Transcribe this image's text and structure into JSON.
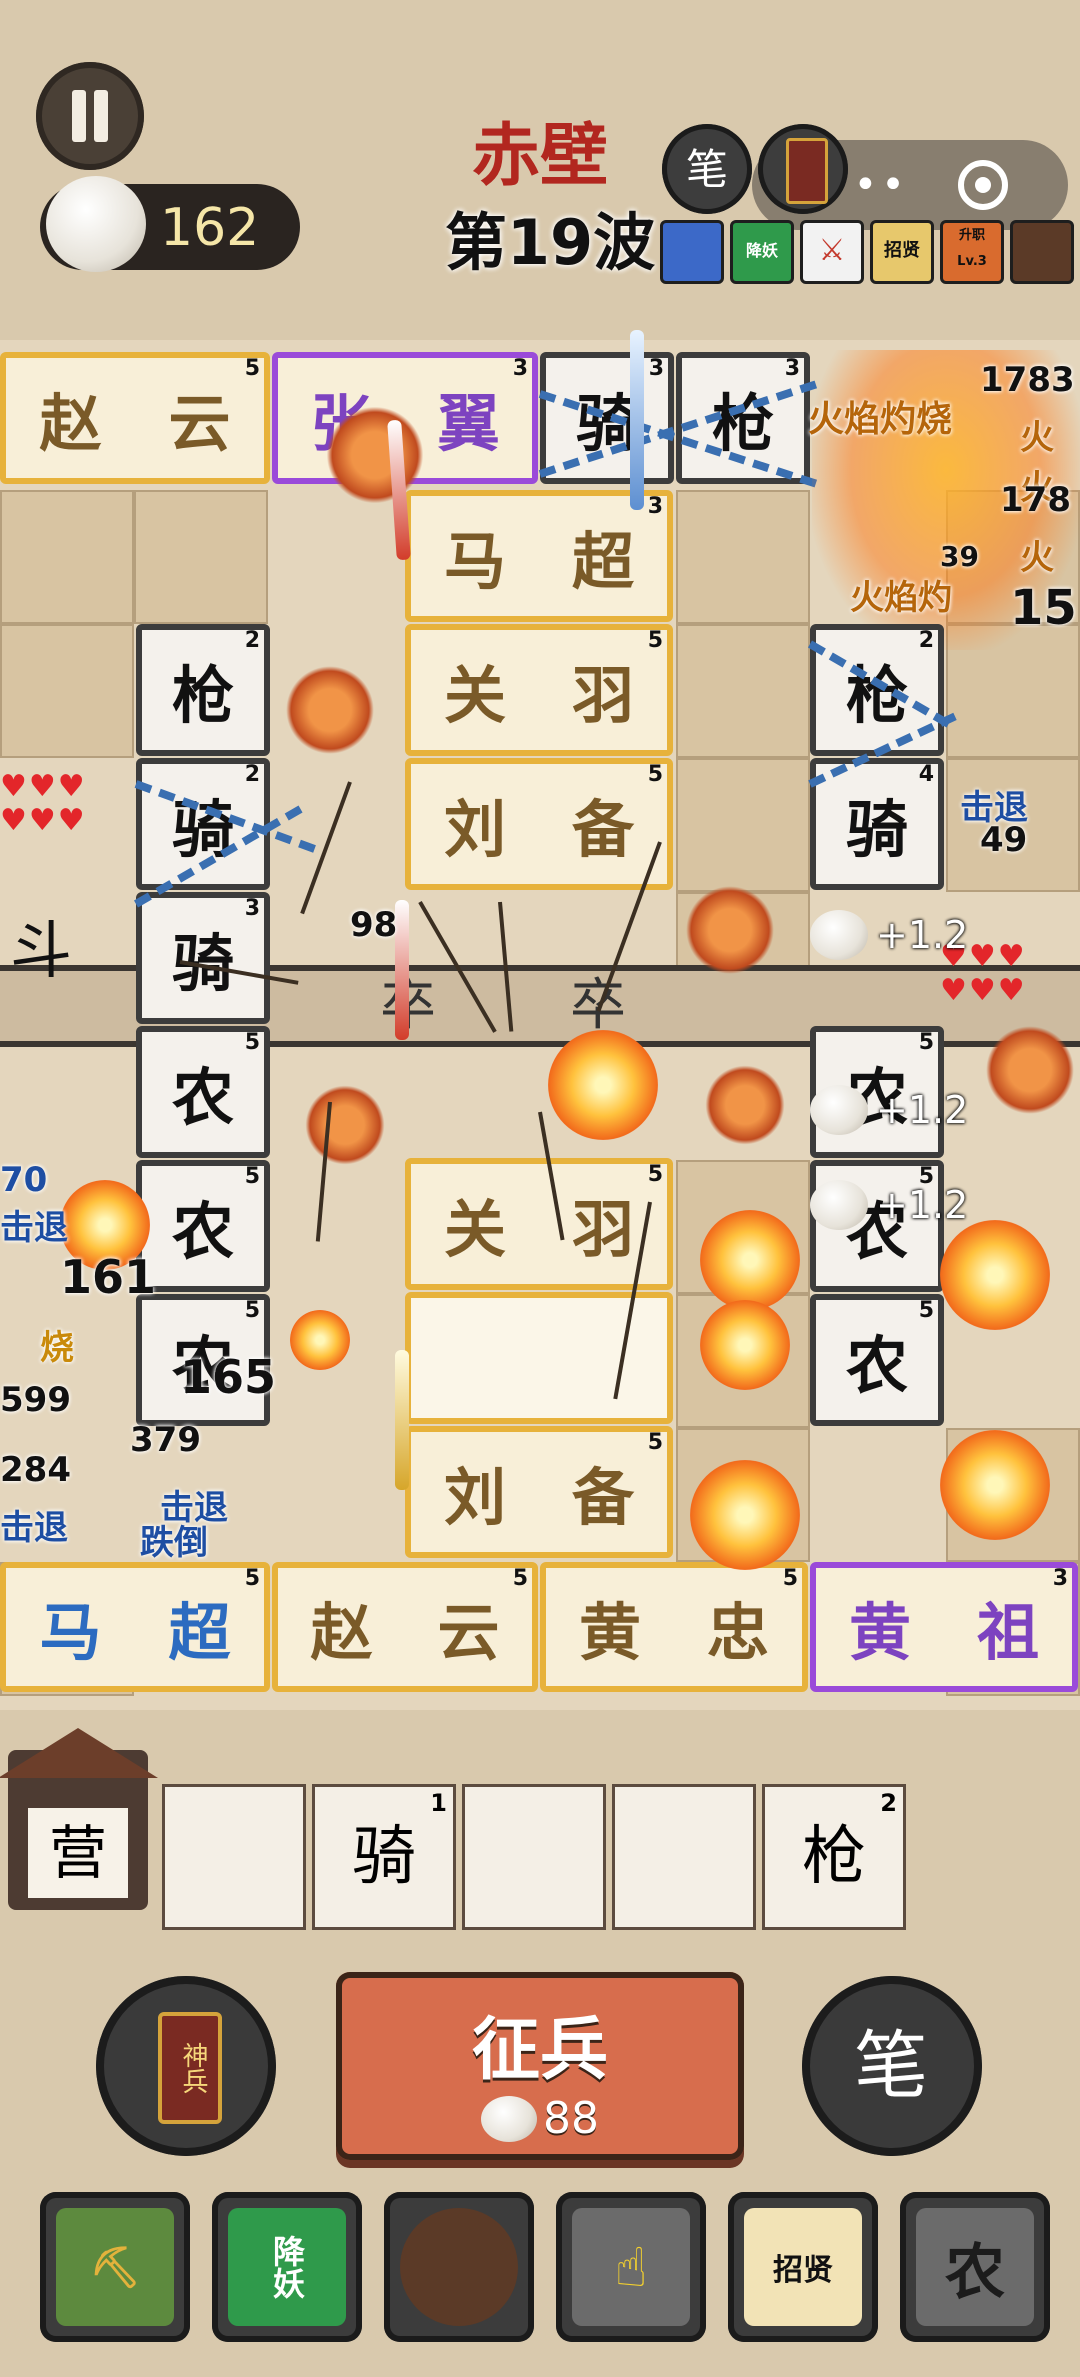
{
  "hud": {
    "coins": "162",
    "stage_title": "赤壁",
    "wave_label": "第19波",
    "pen_label": "笔",
    "divine_card_label": "神兵"
  },
  "buffs": [
    {
      "label": "",
      "color": "#3c69c8"
    },
    {
      "label": "降妖",
      "color": "#2f9a4b"
    },
    {
      "label": "",
      "color": "#c43a2d"
    },
    {
      "label": "招贤",
      "color": "#e7c86c"
    },
    {
      "label": "升职 Lv.3",
      "color": "#d96b2e"
    },
    {
      "label": "",
      "color": "#5b3a27"
    }
  ],
  "board": {
    "top_row": [
      {
        "name": "赵云",
        "chars": [
          "赵",
          "云"
        ],
        "level": "5",
        "style": "gold"
      },
      {
        "name": "张翼",
        "chars": [
          "张",
          "翼"
        ],
        "level": "3",
        "style": "purple"
      },
      {
        "name": "骑",
        "chars": [
          "骑"
        ],
        "level": "3",
        "style": "white"
      },
      {
        "name": "枪",
        "chars": [
          "枪"
        ],
        "level": "3",
        "style": "white"
      },
      {
        "name": "火焰",
        "chars": [],
        "level": "",
        "style": "fire"
      }
    ],
    "center_column": [
      {
        "chars": [
          "马",
          "超"
        ],
        "level": "3"
      },
      {
        "chars": [
          "关",
          "羽"
        ],
        "level": "5"
      },
      {
        "chars": [
          "刘",
          "备"
        ],
        "level": "5"
      },
      {
        "chars": [
          "卒"
        ],
        "level": ""
      },
      {
        "chars": [
          "关",
          "羽"
        ],
        "level": "5"
      },
      {
        "chars": [
          "刘",
          "备"
        ],
        "level": "5"
      }
    ],
    "bottom_row": [
      {
        "chars": [
          "马",
          "超"
        ],
        "level": "5",
        "style": "gold"
      },
      {
        "chars": [
          "赵",
          "云"
        ],
        "level": "5",
        "style": "gold"
      },
      {
        "chars": [
          "黄",
          "忠"
        ],
        "level": "5",
        "style": "gold"
      },
      {
        "chars": [
          "黄",
          "祖"
        ],
        "level": "3",
        "style": "purple"
      }
    ],
    "left_column": [
      {
        "char": "枪",
        "level": "2"
      },
      {
        "char": "骑",
        "level": "2"
      },
      {
        "char": "斗",
        "level": ""
      },
      {
        "char": "骑",
        "level": "3"
      },
      {
        "char": "农",
        "level": "5"
      },
      {
        "char": "农",
        "level": "5"
      },
      {
        "char": "农",
        "level": "5"
      }
    ],
    "right_column": [
      {
        "char": "枪",
        "level": "2"
      },
      {
        "char": "骑",
        "level": "4"
      },
      {
        "char": "农",
        "level": "5"
      },
      {
        "char": "农",
        "level": "5"
      },
      {
        "char": "农",
        "level": "5"
      }
    ],
    "soldier_label": "卒",
    "damage_texts": {
      "fire_burn_1": "火焰灼烧",
      "fire_burn_2": "火焰灼",
      "fire_right_1": "火",
      "fire_right_2": "火",
      "fire_right_3": "火",
      "num_a": "1783",
      "num_b": "178",
      "num_c": "39",
      "num_d": "15",
      "knockback_right": "击退",
      "num_49": "49",
      "num_98": "98",
      "num_70": "70",
      "knockback_left_1": "击退",
      "num_161": "161",
      "burn_left": "烧",
      "num_165": "165",
      "num_left_a": "599",
      "num_left_b": "379",
      "num_left_c": "284",
      "knockback_left_2": "击退",
      "knockback_left_3": "击退",
      "knockdown": "跌倒"
    },
    "plus_coins": [
      "+1.2",
      "+1.2",
      "+1.2"
    ]
  },
  "bench": {
    "camp_label": "营",
    "slots": [
      {
        "char": "",
        "level": ""
      },
      {
        "char": "骑",
        "level": "1"
      },
      {
        "char": "",
        "level": ""
      },
      {
        "char": "",
        "level": ""
      },
      {
        "char": "枪",
        "level": "2"
      }
    ]
  },
  "controls": {
    "recruit_label": "征兵",
    "recruit_cost": "88",
    "left_round_label": "神兵",
    "right_round_label": "笔"
  },
  "toolbar": [
    {
      "name": "shovel",
      "label": ""
    },
    {
      "name": "subdue-demons",
      "label": "降妖"
    },
    {
      "name": "stone",
      "label": ""
    },
    {
      "name": "dig-chest",
      "label": ""
    },
    {
      "name": "recruit-talent",
      "label": "招贤"
    },
    {
      "name": "farmer",
      "label": "农"
    }
  ]
}
